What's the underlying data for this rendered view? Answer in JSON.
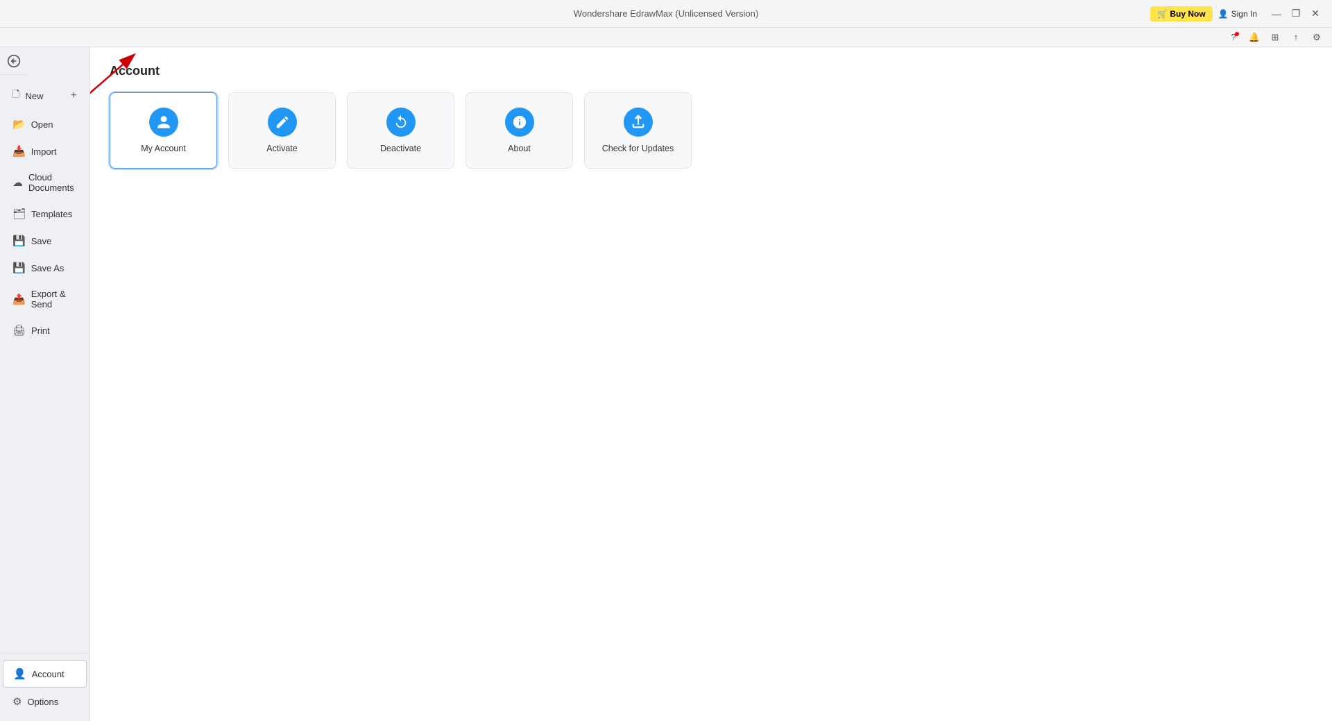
{
  "app": {
    "title": "Wondershare EdrawMax (Unlicensed Version)",
    "buy_now_label": "Buy Now",
    "sign_in_label": "Sign In"
  },
  "window_controls": {
    "minimize": "—",
    "maximize": "❐",
    "close": "✕"
  },
  "toolbar_icons": [
    {
      "name": "help-icon",
      "symbol": "?"
    },
    {
      "name": "notification-icon",
      "symbol": "🔔"
    },
    {
      "name": "community-icon",
      "symbol": "⊞"
    },
    {
      "name": "share-icon",
      "symbol": "↑"
    },
    {
      "name": "settings-icon",
      "symbol": "⚙"
    }
  ],
  "sidebar": {
    "back_title": "Back",
    "items_top": [
      {
        "id": "new",
        "label": "New",
        "icon": "➕",
        "has_plus": true
      },
      {
        "id": "open",
        "label": "Open",
        "icon": "📂"
      },
      {
        "id": "import",
        "label": "Import",
        "icon": "📥"
      },
      {
        "id": "cloud-documents",
        "label": "Cloud Documents",
        "icon": "☁"
      },
      {
        "id": "templates",
        "label": "Templates",
        "icon": "🗂"
      },
      {
        "id": "save",
        "label": "Save",
        "icon": "💾"
      },
      {
        "id": "save-as",
        "label": "Save As",
        "icon": "💾"
      },
      {
        "id": "export-send",
        "label": "Export & Send",
        "icon": "📤"
      },
      {
        "id": "print",
        "label": "Print",
        "icon": "🖨"
      }
    ],
    "items_bottom": [
      {
        "id": "account",
        "label": "Account",
        "icon": "👤",
        "active": true
      },
      {
        "id": "options",
        "label": "Options",
        "icon": "⚙"
      }
    ]
  },
  "page": {
    "title": "Account",
    "cards": [
      {
        "id": "my-account",
        "label": "My Account",
        "icon": "👤",
        "selected": true
      },
      {
        "id": "activate",
        "label": "Activate",
        "icon": "✏"
      },
      {
        "id": "deactivate",
        "label": "Deactivate",
        "icon": "🔄"
      },
      {
        "id": "about",
        "label": "About",
        "icon": "❓"
      },
      {
        "id": "check-updates",
        "label": "Check for Updates",
        "icon": "⬆"
      }
    ]
  }
}
